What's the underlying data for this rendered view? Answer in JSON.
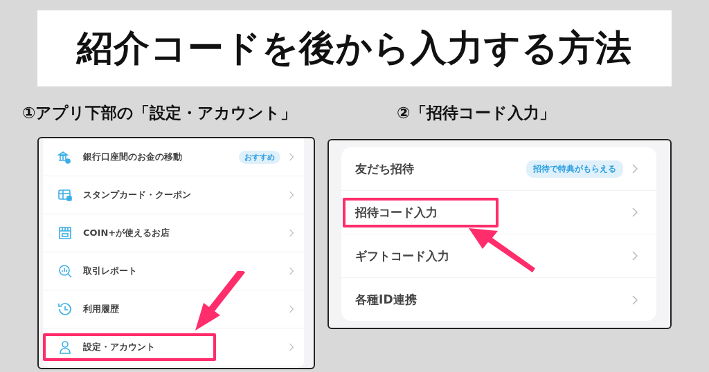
{
  "title": "紹介コードを後から入力する方法",
  "steps": [
    {
      "label": "①アプリ下部の「設定・アカウント」"
    },
    {
      "label": "②「招待コード入力」"
    }
  ],
  "left_menu": [
    {
      "label": "銀行口座間のお金の移動",
      "badge": "おすすめ",
      "highlighted": false
    },
    {
      "label": "スタンプカード・クーポン",
      "highlighted": false
    },
    {
      "label": "COIN+が使えるお店",
      "highlighted": false
    },
    {
      "label": "取引レポート",
      "highlighted": false
    },
    {
      "label": "利用履歴",
      "highlighted": false
    },
    {
      "label": "設定・アカウント",
      "highlighted": true
    }
  ],
  "right_menu": [
    {
      "label": "友だち招待",
      "badge": "招待で特典がもらえる",
      "highlighted": false
    },
    {
      "label": "招待コード入力",
      "highlighted": true
    },
    {
      "label": "ギフトコード入力",
      "highlighted": false
    },
    {
      "label": "各種ID連携",
      "highlighted": false
    }
  ]
}
